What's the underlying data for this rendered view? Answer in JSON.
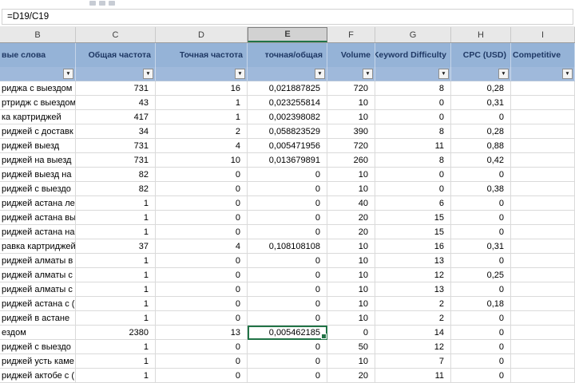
{
  "formula_bar": {
    "formula": "=D19/C19"
  },
  "icons": {
    "filter_arrow": "▼"
  },
  "colors": {
    "header_fill": "#95B3D7",
    "header_text": "#1F3864",
    "selection_green": "#217346",
    "gridline": "#DADADA"
  },
  "columns": {
    "letters": [
      "B",
      "C",
      "D",
      "E",
      "F",
      "G",
      "H",
      "I"
    ],
    "selected": "E"
  },
  "selection": {
    "row_index": 17,
    "column_key": "e"
  },
  "table": {
    "headers": [
      "вые слова",
      "Общая частота",
      "Точная частота",
      "точная/общая",
      "Volume",
      "Keyword Difficulty",
      "CPC (USD)",
      "Competitive"
    ],
    "rows": [
      {
        "keyword": "риджа с выездом",
        "c": "731",
        "d": "16",
        "e": "0,021887825",
        "f": "720",
        "g": "8",
        "h": "0,28"
      },
      {
        "keyword": "ртридж с выездом",
        "c": "43",
        "d": "1",
        "e": "0,023255814",
        "f": "10",
        "g": "0",
        "h": "0,31"
      },
      {
        "keyword": "ка картриджей",
        "c": "417",
        "d": "1",
        "e": "0,002398082",
        "f": "10",
        "g": "0",
        "h": "0"
      },
      {
        "keyword": "риджей с доставк",
        "c": "34",
        "d": "2",
        "e": "0,058823529",
        "f": "390",
        "g": "8",
        "h": "0,28"
      },
      {
        "keyword": "риджей выезд",
        "c": "731",
        "d": "4",
        "e": "0,005471956",
        "f": "720",
        "g": "11",
        "h": "0,88"
      },
      {
        "keyword": "риджей на выезд",
        "c": "731",
        "d": "10",
        "e": "0,013679891",
        "f": "260",
        "g": "8",
        "h": "0,42"
      },
      {
        "keyword": "риджей выезд на",
        "c": "82",
        "d": "0",
        "e": "0",
        "f": "10",
        "g": "0",
        "h": "0"
      },
      {
        "keyword": "риджей с выездо",
        "c": "82",
        "d": "0",
        "e": "0",
        "f": "10",
        "g": "0",
        "h": "0,38"
      },
      {
        "keyword": "риджей астана ле",
        "c": "1",
        "d": "0",
        "e": "0",
        "f": "40",
        "g": "6",
        "h": "0"
      },
      {
        "keyword": "риджей астана вы",
        "c": "1",
        "d": "0",
        "e": "0",
        "f": "20",
        "g": "15",
        "h": "0"
      },
      {
        "keyword": "риджей астана на",
        "c": "1",
        "d": "0",
        "e": "0",
        "f": "20",
        "g": "15",
        "h": "0"
      },
      {
        "keyword": "равка картриджей",
        "c": "37",
        "d": "4",
        "e": "0,108108108",
        "f": "10",
        "g": "16",
        "h": "0,31"
      },
      {
        "keyword": "риджей алматы в",
        "c": "1",
        "d": "0",
        "e": "0",
        "f": "10",
        "g": "13",
        "h": "0"
      },
      {
        "keyword": "риджей алматы с",
        "c": "1",
        "d": "0",
        "e": "0",
        "f": "10",
        "g": "12",
        "h": "0,25"
      },
      {
        "keyword": "риджей алматы с",
        "c": "1",
        "d": "0",
        "e": "0",
        "f": "10",
        "g": "13",
        "h": "0"
      },
      {
        "keyword": "риджей астана с (",
        "c": "1",
        "d": "0",
        "e": "0",
        "f": "10",
        "g": "2",
        "h": "0,18"
      },
      {
        "keyword": "риджей в астане",
        "c": "1",
        "d": "0",
        "e": "0",
        "f": "10",
        "g": "2",
        "h": "0"
      },
      {
        "keyword": "ездом",
        "c": "2380",
        "d": "13",
        "e": "0,005462185",
        "f": "0",
        "g": "14",
        "h": "0"
      },
      {
        "keyword": "риджей с выездо",
        "c": "1",
        "d": "0",
        "e": "0",
        "f": "50",
        "g": "12",
        "h": "0"
      },
      {
        "keyword": "риджей усть каме",
        "c": "1",
        "d": "0",
        "e": "0",
        "f": "10",
        "g": "7",
        "h": "0"
      },
      {
        "keyword": "риджей актобе с (",
        "c": "1",
        "d": "0",
        "e": "0",
        "f": "20",
        "g": "11",
        "h": "0"
      }
    ]
  }
}
